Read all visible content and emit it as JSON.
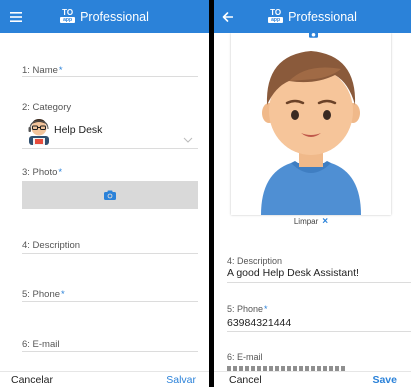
{
  "app": {
    "title": "Professional"
  },
  "form_left": {
    "name_label": "1: Name",
    "category_label": "2: Category",
    "category_value": "Help Desk",
    "photo_label": "3: Photo",
    "description_label": "4: Description",
    "phone_label": "5: Phone",
    "email_label": "6: E-mail",
    "required_mark": "*"
  },
  "footer_left": {
    "cancel_label": "Cancelar",
    "save_label": "Salvar"
  },
  "form_right": {
    "clear_label": "Limpar",
    "clear_icon": "×",
    "description_label": "4: Description",
    "description_value": "A good Help Desk Assistant!",
    "phone_label": "5: Phone",
    "phone_value": "63984321444",
    "email_label": "6: E-mail",
    "required_mark": "*"
  },
  "footer_right": {
    "cancel_label": "Cancel",
    "save_label": "Save"
  },
  "colors": {
    "primary": "#2b82d9",
    "divider": "#dcdcdc",
    "photo_bg": "#d9d9d9"
  },
  "icons": {
    "menu": "hamburger-menu-icon",
    "back": "arrow-left-icon",
    "camera": "camera-icon",
    "chevron": "chevron-down-icon",
    "clear": "close-icon"
  }
}
